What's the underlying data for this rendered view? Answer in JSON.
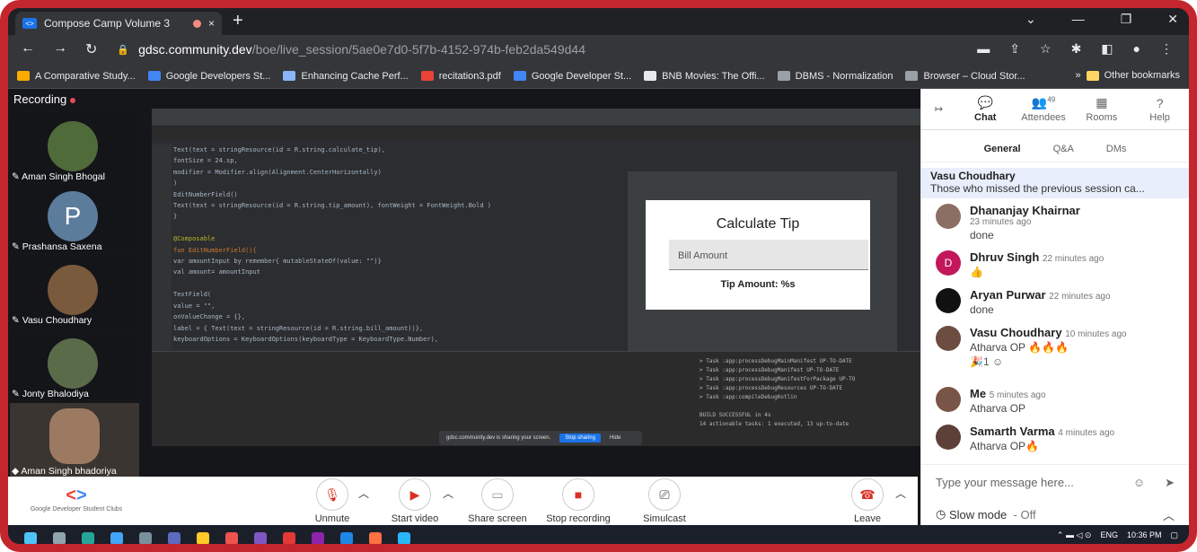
{
  "browser": {
    "tab_title": "Compose Camp Volume 3",
    "tab_close": "×",
    "new_tab": "+",
    "url_host": "gdsc.community.dev",
    "url_path": "/boe/live_session/5ae0e7d0-5f7b-4152-974b-feb2da549d44",
    "bookmarks": [
      "A Comparative Study...",
      "Google Developers St...",
      "Enhancing Cache Perf...",
      "recitation3.pdf",
      "Google Developer St...",
      "BNB Movies: The Offi...",
      "DBMS - Normalization",
      "Browser – Cloud Stor..."
    ],
    "bookmark_colors": [
      "#f9ab00",
      "#4285f4",
      "#8ab4f8",
      "#ea4335",
      "#4285f4",
      "#e8eaed",
      "#9aa0a6",
      "#9aa0a6"
    ],
    "other_bookmarks": "Other bookmarks",
    "overflow": "»"
  },
  "recording": {
    "label": "Recording"
  },
  "participants": [
    {
      "name": "Aman Singh Bhogal",
      "initial": ""
    },
    {
      "name": "Prashansa Saxena",
      "initial": "P"
    },
    {
      "name": "Vasu Choudhary",
      "initial": ""
    },
    {
      "name": "Jonty Bhalodiya",
      "initial": ""
    },
    {
      "name": "Aman Singh bhadoriya",
      "initial": ""
    }
  ],
  "shared_screen": {
    "code_lines": [
      "    Text(text = stringResource(id = R.string.calculate_tip),",
      "        fontSize = 24.sp,",
      "        modifier = Modifier.align(Alignment.CenterHorizontally)",
      "    )",
      "    EditNumberField()",
      "    Text(text = stringResource(id = R.string.tip_amount), fontWeight = FontWeight.Bold )",
      "}",
      "",
      "@Composable",
      "fun EditNumberField(){",
      "    var amountInput by remember{ mutableStateOf(value: \"\")}",
      "    val amount= amountInput",
      "",
      "    TextField(",
      "        value = \"\",",
      "        onValueChange = {},",
      "        label = { Text(text = stringResource(id = R.string.bill_amount))},",
      "        keyboardOptions = KeyboardOptions(keyboardType = KeyboardType.Number),"
    ],
    "preview_title": "Calculate Tip",
    "bill_placeholder": "Bill Amount",
    "tip_label": "Tip Amount: %s",
    "build_log": [
      "> Task :app:processDebugMainManifest UP-TO-DATE",
      "> Task :app:processDebugManifest UP-TO-DATE",
      "> Task :app:processDebugManifestForPackage UP-TO",
      "> Task :app:processDebugResources UP-TO-DATE",
      "> Task :app:compileDebugKotlin",
      "",
      "BUILD SUCCESSFUL in 4s",
      "14 actionable tasks: 1 executed, 13 up-to-date"
    ],
    "share_banner": "gdsc.community.dev is sharing your screen.",
    "stop_sharing": "Stop sharing",
    "hide": "Hide"
  },
  "controls": {
    "club_caption": "Google Developer Student Clubs",
    "unmute": "Unmute",
    "start_video": "Start video",
    "share_screen": "Share screen",
    "stop_recording": "Stop recording",
    "simulcast": "Simulcast",
    "leave": "Leave"
  },
  "panel": {
    "tabs": [
      "Chat",
      "Attendees",
      "Rooms",
      "Help"
    ],
    "attendee_count": "49",
    "subtabs": [
      "General",
      "Q&A",
      "DMs"
    ],
    "pinned_name": "Vasu Choudhary",
    "pinned_text": "Those who missed the previous session ca...",
    "messages": [
      {
        "name": "Dhananjay Khairnar",
        "time": "23 minutes ago",
        "text": "done",
        "color": "#8d6e63",
        "initial": ""
      },
      {
        "name": "Dhruv Singh",
        "time": "22 minutes ago",
        "text": "👍",
        "color": "#c2185b",
        "initial": "D"
      },
      {
        "name": "Aryan Purwar",
        "time": "22 minutes ago",
        "text": "done",
        "color": "#111111",
        "initial": ""
      },
      {
        "name": "Vasu Choudhary",
        "time": "10 minutes ago",
        "text": "Atharva OP 🔥🔥🔥",
        "color": "#6d4c41",
        "initial": ""
      },
      {
        "name": "Me",
        "time": "5 minutes ago",
        "text": "Atharva OP",
        "color": "#795548",
        "initial": ""
      },
      {
        "name": "Samarth Varma",
        "time": "4 minutes ago",
        "text": "Atharva OP🔥",
        "color": "#5d4037",
        "initial": ""
      }
    ],
    "reaction_count": "1",
    "input_placeholder": "Type your message here...",
    "slow_mode": "Slow mode",
    "slow_mode_state": "- Off"
  },
  "taskbar": {
    "lang": "ENG",
    "time": "10:36 PM"
  }
}
